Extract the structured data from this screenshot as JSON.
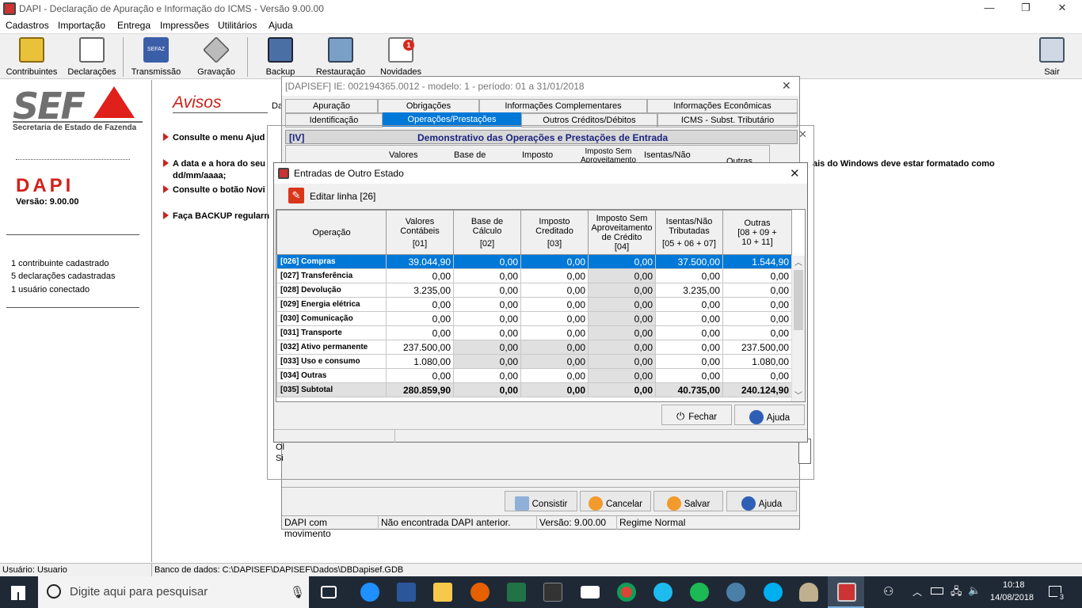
{
  "window": {
    "title": "DAPI - Declaração de Apuração e Informação do ICMS - Versão 9.00.00",
    "minimize": "—",
    "maximize": "❐",
    "close": "✕"
  },
  "menu": [
    "Cadastros",
    "Importação",
    "Entrega",
    "Impressões",
    "Utilitários",
    "Ajuda"
  ],
  "toolbar": {
    "contribuintes": "Contribuintes",
    "declaracoes": "Declarações",
    "transmissao": "Transmissão",
    "gravacao": "Gravação",
    "backup": "Backup",
    "restauracao": "Restauração",
    "novidades": "Novidades",
    "novidades_badge": "1",
    "sair": "Sair",
    "sefaz_badge": "SEFAZ"
  },
  "left": {
    "logo": "SEF",
    "logo_sub": "Secretaria de Estado de Fazenda",
    "dapi": "DAPI",
    "versao": "Versão: 9.00.00",
    "stats": [
      "1 contribuinte cadastrado",
      "5 declarações cadastradas",
      "1 usuário conectado"
    ]
  },
  "avisos": {
    "title": "Avisos",
    "da": "Da",
    "lines": [
      "Consulte o menu Ajud",
      "A data e a hora do seu",
      "dd/mm/aaaa;",
      "Consulte o botão Novi",
      "Faça BACKUP regularn"
    ],
    "right_text": "ais do Windows deve estar formatado como"
  },
  "declaration": {
    "title": "[DAPISEF] IE: 002194365.0012 -  modelo: 1 -  período: 01 a 31/01/2018",
    "close": "✕",
    "tabs_row1": [
      "Apuração",
      "Obrigações",
      "Informações Complementares",
      "Informações Econômicas"
    ],
    "tabs_row2": [
      "Identificação",
      "Operações/Prestações",
      "Outros Créditos/Débitos",
      "ICMS - Subst. Tributário"
    ],
    "section_code": "[IV]",
    "section_title": "Demonstrativo das Operações e Prestações de Entrada",
    "bg_headers": [
      "Valores",
      "Base de",
      "Imposto",
      "Imposto Sem Aproveitamento",
      "Isentas/Não",
      "Outras"
    ],
    "bg_left_text": [
      "Ol",
      "Si"
    ],
    "buttons": {
      "consistir": "Consistir",
      "cancelar": "Cancelar",
      "salvar": "Salvar",
      "ajuda": "Ajuda"
    },
    "status": [
      "DAPI com movimento",
      "Não encontrada DAPI anterior.",
      "Versão: 9.00.00",
      "Regime Normal"
    ]
  },
  "entradas": {
    "title": "Entradas de Outro Estado",
    "close": "✕",
    "edit_label": "Editar linha [26]",
    "headers": [
      {
        "label": "Operação",
        "code": ""
      },
      {
        "label": "Valores Contábeis",
        "code": "[01]"
      },
      {
        "label": "Base de Cálculo",
        "code": "[02]"
      },
      {
        "label": "Imposto Creditado",
        "code": "[03]"
      },
      {
        "label": "Imposto Sem Aproveitamento de Crédito",
        "code": "[04]"
      },
      {
        "label": "Isentas/Não Tributadas",
        "code": "[05 + 06 + 07]"
      },
      {
        "label": "Outras",
        "code": "[08 + 09 + 10 + 11]"
      }
    ],
    "rows": [
      {
        "op": "[026] Compras",
        "v": [
          "39.044,90",
          "0,00",
          "0,00",
          "0,00",
          "37.500,00",
          "1.544,90"
        ]
      },
      {
        "op": "[027] Transferência",
        "v": [
          "0,00",
          "0,00",
          "0,00",
          "0,00",
          "0,00",
          "0,00"
        ]
      },
      {
        "op": "[028] Devolução",
        "v": [
          "3.235,00",
          "0,00",
          "0,00",
          "0,00",
          "3.235,00",
          "0,00"
        ]
      },
      {
        "op": "[029] Energia elétrica",
        "v": [
          "0,00",
          "0,00",
          "0,00",
          "0,00",
          "0,00",
          "0,00"
        ]
      },
      {
        "op": "[030] Comunicação",
        "v": [
          "0,00",
          "0,00",
          "0,00",
          "0,00",
          "0,00",
          "0,00"
        ]
      },
      {
        "op": "[031] Transporte",
        "v": [
          "0,00",
          "0,00",
          "0,00",
          "0,00",
          "0,00",
          "0,00"
        ]
      },
      {
        "op": "[032] Ativo permanente",
        "v": [
          "237.500,00",
          "0,00",
          "0,00",
          "0,00",
          "0,00",
          "237.500,00"
        ]
      },
      {
        "op": "[033] Uso e consumo",
        "v": [
          "1.080,00",
          "0,00",
          "0,00",
          "0,00",
          "0,00",
          "1.080,00"
        ]
      },
      {
        "op": "[034] Outras",
        "v": [
          "0,00",
          "0,00",
          "0,00",
          "0,00",
          "0,00",
          "0,00"
        ]
      },
      {
        "op": "[035] Subtotal",
        "v": [
          "280.859,90",
          "0,00",
          "0,00",
          "0,00",
          "40.735,00",
          "240.124,90"
        ]
      }
    ],
    "buttons": {
      "fechar": "Fechar",
      "ajuda": "Ajuda"
    }
  },
  "statusbar": {
    "usuario": "Usuário: Usuario",
    "banco": "Banco de dados: C:\\DAPISEF\\DAPISEF\\Dados\\DBDapisef.GDB"
  },
  "taskbar": {
    "search_placeholder": "Digite aqui para pesquisar",
    "time": "10:18",
    "date": "14/08/2018",
    "notif_count": "3"
  }
}
